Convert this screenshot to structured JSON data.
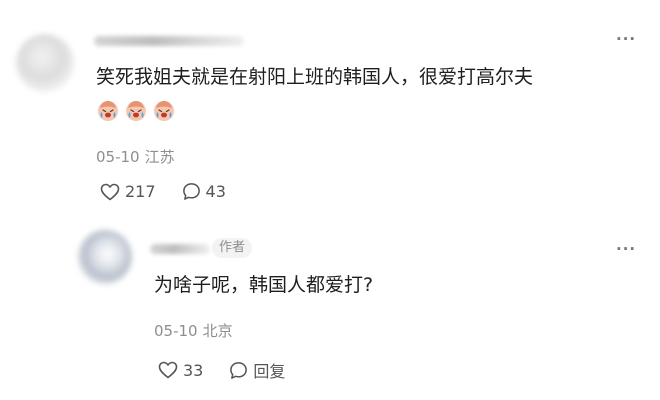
{
  "comment": {
    "text": "笑死我姐夫就是在射阳上班的韩国人，很爱打高尔夫",
    "emojis": [
      "crying-laughing-emoji",
      "crying-laughing-emoji",
      "crying-laughing-emoji"
    ],
    "date": "05-10",
    "location": "江苏",
    "likes": "217",
    "replies": "43"
  },
  "reply": {
    "badge": "作者",
    "text": "为啥子呢，韩国人都爱打?",
    "date": "05-10",
    "location": "北京",
    "likes": "33",
    "reply_label": "回复"
  },
  "more_label": "···"
}
